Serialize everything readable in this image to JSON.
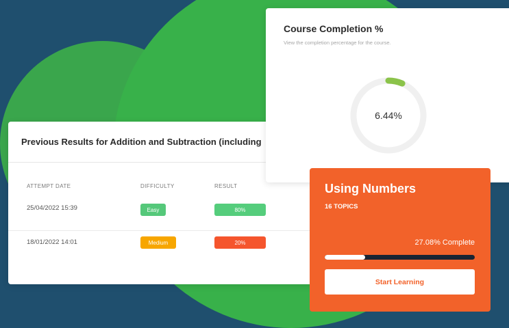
{
  "colors": {
    "background": "#1f4f6e",
    "blob_green": "#38b14a",
    "accent_orange": "#f2622a",
    "easy_green": "#55c87a",
    "medium_amber": "#f7a600",
    "low_result_red": "#f5552d",
    "good_result_green": "#55cd7c",
    "donut_track": "#f0f0f0",
    "donut_progress": "#8bc34a"
  },
  "results": {
    "title": "Previous Results for Addition and Subtraction (including",
    "columns": {
      "date": "ATTEMPT DATE",
      "difficulty": "DIFFICULTY",
      "result": "RESULT"
    },
    "rows": [
      {
        "date": "25/04/2022 15:39",
        "difficulty": "Easy",
        "result": "80%"
      },
      {
        "date": "18/01/2022 14:01",
        "difficulty": "Medium",
        "result": "20%"
      }
    ]
  },
  "completion": {
    "title": "Course Completion %",
    "subtitle": "View the completion percentage for the course.",
    "percent": 6.44,
    "percent_label": "6.44%"
  },
  "course": {
    "title": "Using Numbers",
    "topics": "16 TOPICS",
    "complete_label": "27.08% Complete",
    "progress": 0.2708,
    "cta_label": "Start Learning"
  }
}
